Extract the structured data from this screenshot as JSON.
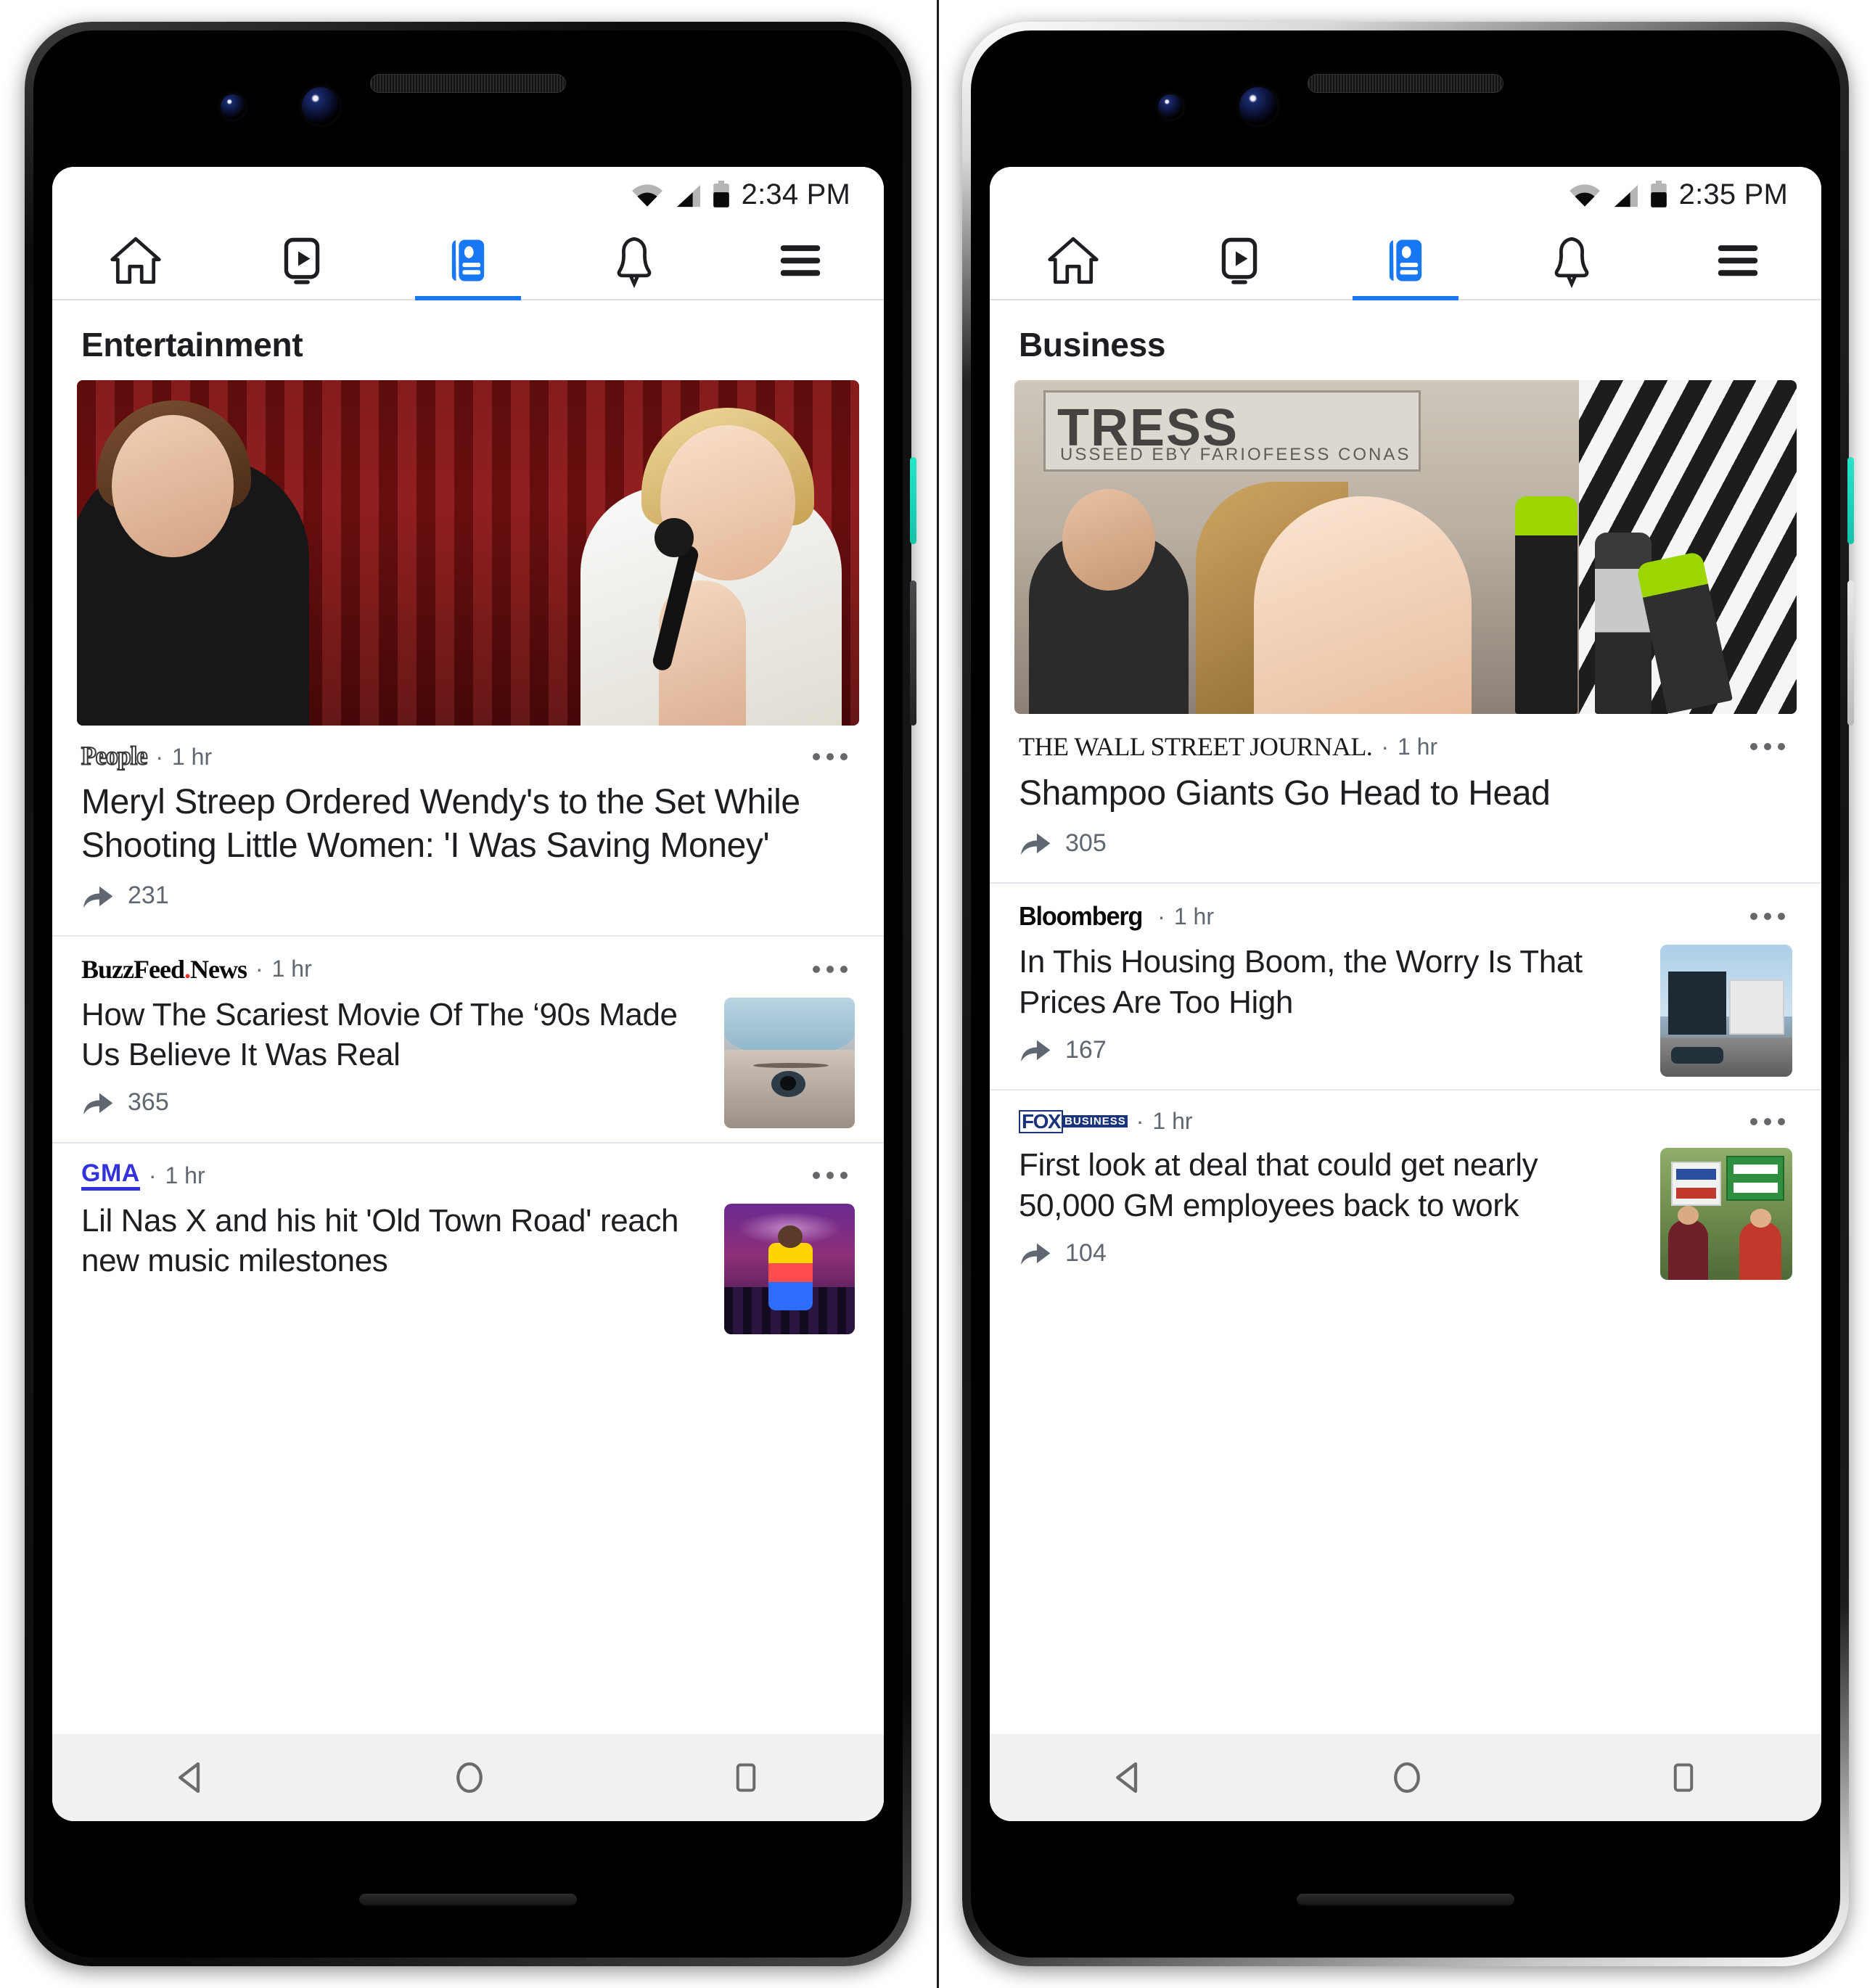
{
  "app": {
    "name": "Facebook News Tab"
  },
  "phones": [
    {
      "id": "left",
      "status": {
        "time": "2:34 PM",
        "wifi": "wifi-icon",
        "signal": "cell-signal-icon",
        "battery": "battery-icon"
      },
      "nav": {
        "tabs": [
          {
            "name": "home",
            "icon": "home-icon",
            "active": false
          },
          {
            "name": "watch",
            "icon": "video-icon",
            "active": false
          },
          {
            "name": "news",
            "icon": "news-icon",
            "active": true
          },
          {
            "name": "notifications",
            "icon": "bell-icon",
            "active": false
          },
          {
            "name": "menu",
            "icon": "hamburger-menu-icon",
            "active": false
          }
        ]
      },
      "section_title": "Entertainment",
      "articles": [
        {
          "source": "People",
          "source_style": "people",
          "age": "1 hr",
          "headline": "Meryl Streep Ordered Wendy's to the Set While Shooting Little Women: 'I Was Saving Money'",
          "shares": "231",
          "layout": "hero",
          "image": "ent-hero"
        },
        {
          "source": "BuzzFeed.News",
          "source_style": "buzzfeed",
          "age": "1 hr",
          "headline": "How The Scariest Movie Of The ‘90s Made Us Believe It Was Real",
          "shares": "365",
          "layout": "thumb",
          "image": "eye-thumb"
        },
        {
          "source": "GMA",
          "source_style": "gma",
          "age": "1 hr",
          "headline": "Lil Nas X and his hit 'Old Town Road' reach new music milestones",
          "shares": "",
          "layout": "thumb",
          "image": "lilnasx-thumb"
        }
      ],
      "sysnav": [
        {
          "name": "back-button",
          "icon": "triangle-back-icon"
        },
        {
          "name": "home-button",
          "icon": "circle-home-icon"
        },
        {
          "name": "recents-button",
          "icon": "square-recents-icon"
        }
      ]
    },
    {
      "id": "right",
      "status": {
        "time": "2:35 PM",
        "wifi": "wifi-icon",
        "signal": "cell-signal-icon",
        "battery": "battery-icon"
      },
      "nav": {
        "tabs": [
          {
            "name": "home",
            "icon": "home-icon",
            "active": false
          },
          {
            "name": "watch",
            "icon": "video-icon",
            "active": false
          },
          {
            "name": "news",
            "icon": "news-icon",
            "active": true
          },
          {
            "name": "notifications",
            "icon": "bell-icon",
            "active": false
          },
          {
            "name": "menu",
            "icon": "hamburger-menu-icon",
            "active": false
          }
        ]
      },
      "section_title": "Business",
      "articles": [
        {
          "source": "THE WALL STREET JOURNAL.",
          "source_style": "wsj",
          "age": "1 hr",
          "headline": "Shampoo Giants Go Head to Head",
          "shares": "305",
          "layout": "hero",
          "image": "salon-hero"
        },
        {
          "source": "Bloomberg",
          "source_style": "bloomberg",
          "age": "1 hr",
          "headline": "In This Housing Boom, the Worry Is That Prices Are Too High",
          "shares": "167",
          "layout": "thumb",
          "image": "house-thumb"
        },
        {
          "source": "FOX BUSINESS",
          "source_style": "fox",
          "age": "1 hr",
          "headline": "First look at deal that could get nearly 50,000 GM employees back to work",
          "shares": "104",
          "layout": "thumb",
          "image": "uaw-thumb"
        }
      ],
      "sysnav": [
        {
          "name": "back-button",
          "icon": "triangle-back-icon"
        },
        {
          "name": "home-button",
          "icon": "circle-home-icon"
        },
        {
          "name": "recents-button",
          "icon": "square-recents-icon"
        }
      ]
    }
  ],
  "colors": {
    "accent_blue": "#1877f2",
    "text_primary": "#1c1e21",
    "text_secondary": "#606770",
    "divider": "#e4e6eb",
    "gma_blue": "#3333dd",
    "buzzfeed_red": "#ee3322",
    "fox_navy": "#19347a",
    "sysnav_bg": "#f1f1f1"
  },
  "logo_text": {
    "people": "People",
    "buzzfeed_a": "BuzzFeed",
    "buzzfeed_dot": ".",
    "buzzfeed_b": "News",
    "gma": "GMA",
    "wsj": "THE WALL STREET JOURNAL.",
    "bloomberg": "Bloomberg",
    "fox_top": "FOX",
    "fox_bottom": "BUSINESS",
    "separator": "·"
  }
}
